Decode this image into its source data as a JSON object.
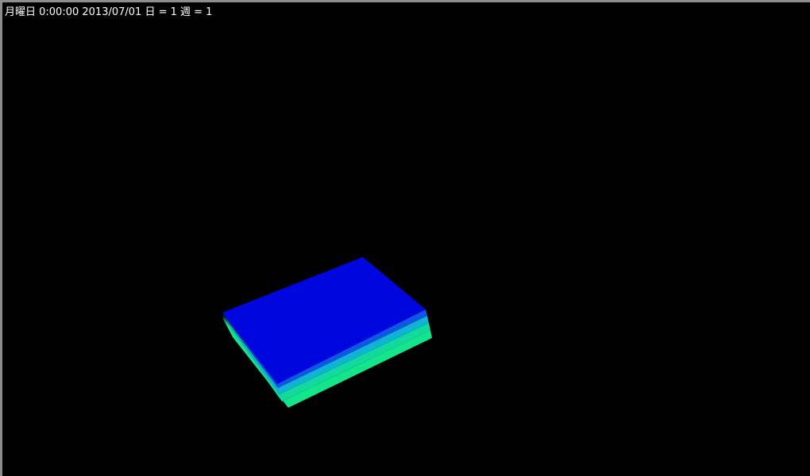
{
  "overlay": {
    "status_text": "月曜日 0:00:00 2013/07/01 日 = 1 週 = 1"
  },
  "scene": {
    "background": "#000000",
    "block": {
      "top_color": "#0006de",
      "layer_colors": [
        "#0f55e6",
        "#0fb4d4",
        "#12d99e",
        "#14e58a"
      ]
    }
  }
}
